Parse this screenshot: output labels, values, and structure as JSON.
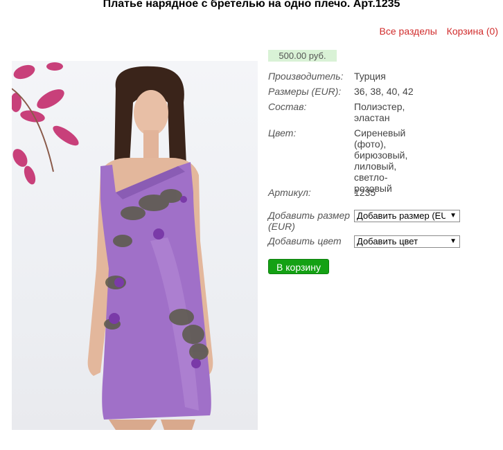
{
  "page": {
    "title": "Платье нарядное с бретелью на одно плечо. Арт.1235"
  },
  "nav": {
    "all_sections": "Все разделы",
    "cart": "Корзина (0)"
  },
  "product": {
    "price": "500.00 руб.",
    "specs": [
      {
        "label": "Производитель:",
        "value": "Турция"
      },
      {
        "label": "Размеры (EUR):",
        "value": "36, 38, 40, 42"
      },
      {
        "label": "Состав:",
        "value": "Полиэстер, эластан"
      },
      {
        "label": "Цвет:",
        "value": "Сиреневый (фото), бирюзовый, лиловый, светло-розовый"
      },
      {
        "label": "Артикул:",
        "value": "1235"
      }
    ],
    "add_size": {
      "label": "Добавить размер (EUR)",
      "selected": "Добавить размер (EU"
    },
    "add_color": {
      "label": "Добавить цвет",
      "selected": "Добавить цвет"
    },
    "add_to_cart": "В корзину"
  },
  "colors": {
    "link": "#d12c2c",
    "price_bg": "#d9f2d6",
    "button": "#14a114",
    "dress": "#a070c8"
  }
}
